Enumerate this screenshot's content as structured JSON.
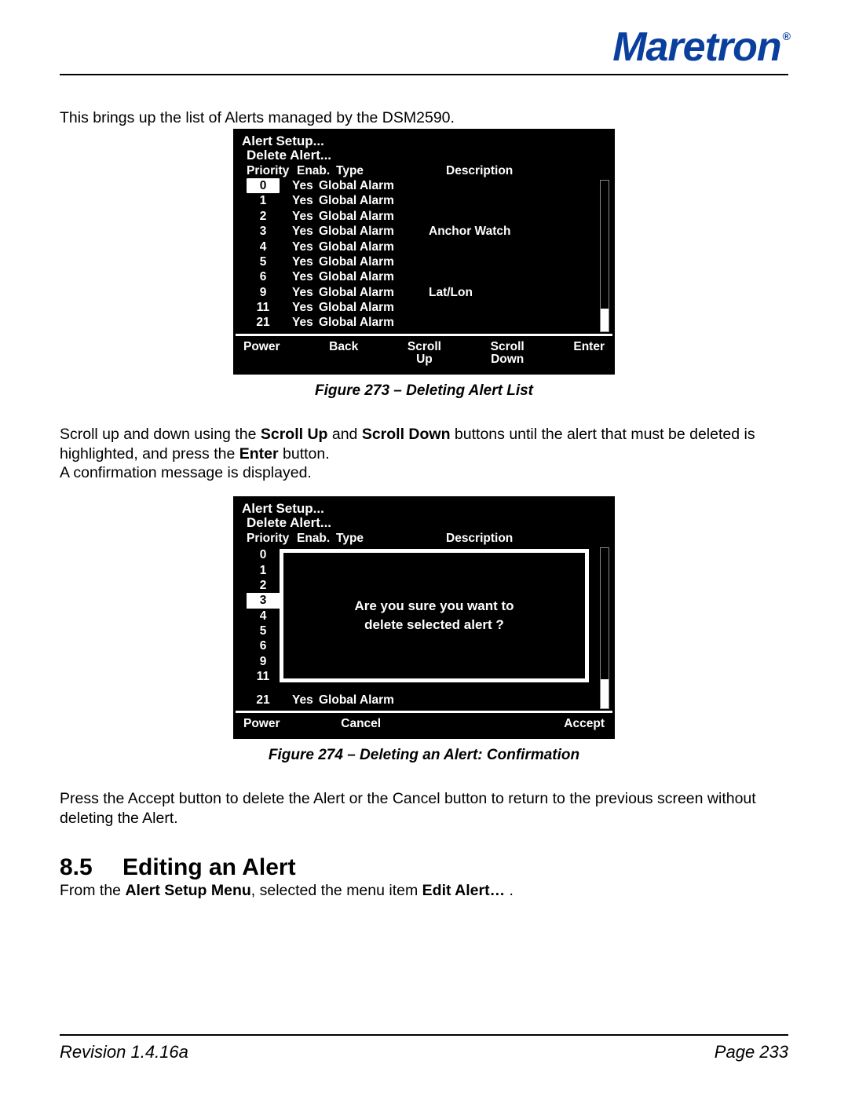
{
  "brand": {
    "name": "Maretron",
    "reg": "®"
  },
  "intro": "This brings up the list of Alerts managed by the DSM2590.",
  "device1": {
    "crumb1": "Alert Setup...",
    "crumb2": "Delete Alert...",
    "headers": {
      "priority": "Priority",
      "enab": "Enab.",
      "type": "Type",
      "desc": "Description"
    },
    "rows": [
      {
        "p": "0",
        "e": "Yes",
        "t": "Global Alarm",
        "d": "",
        "sel": true
      },
      {
        "p": "1",
        "e": "Yes",
        "t": "Global Alarm",
        "d": "",
        "sel": false
      },
      {
        "p": "2",
        "e": "Yes",
        "t": "Global Alarm",
        "d": "",
        "sel": false
      },
      {
        "p": "3",
        "e": "Yes",
        "t": "Global Alarm",
        "d": "Anchor Watch",
        "sel": false
      },
      {
        "p": "4",
        "e": "Yes",
        "t": "Global Alarm",
        "d": "",
        "sel": false
      },
      {
        "p": "5",
        "e": "Yes",
        "t": "Global Alarm",
        "d": "",
        "sel": false
      },
      {
        "p": "6",
        "e": "Yes",
        "t": "Global Alarm",
        "d": "",
        "sel": false
      },
      {
        "p": "9",
        "e": "Yes",
        "t": "Global Alarm",
        "d": "Lat/Lon",
        "sel": false
      },
      {
        "p": "11",
        "e": "Yes",
        "t": "Global Alarm",
        "d": "",
        "sel": false
      },
      {
        "p": "21",
        "e": "Yes",
        "t": "Global Alarm",
        "d": "",
        "sel": false
      }
    ],
    "softkeys": {
      "k1": "Power",
      "k2": "Back",
      "k3a": "Scroll",
      "k3b": "Up",
      "k4a": "Scroll",
      "k4b": "Down",
      "k5": "Enter"
    }
  },
  "caption1": "Figure 273 – Deleting Alert List",
  "mid_text": {
    "l1a": "Scroll up and down using the ",
    "b1": "Scroll Up",
    "l1b": " and ",
    "b2": "Scroll Down",
    "l1c": " buttons until the alert that must be deleted is highlighted, and press the ",
    "b3": "Enter",
    "l1d": " button.",
    "l2": "A confirmation message is displayed."
  },
  "device2": {
    "crumb1": "Alert Setup...",
    "crumb2": "Delete Alert...",
    "headers": {
      "priority": "Priority",
      "enab": "Enab.",
      "type": "Type",
      "desc": "Description"
    },
    "priorities": [
      {
        "p": "0",
        "sel": false
      },
      {
        "p": "1",
        "sel": false
      },
      {
        "p": "2",
        "sel": false
      },
      {
        "p": "3",
        "sel": true
      },
      {
        "p": "4",
        "sel": false
      },
      {
        "p": "5",
        "sel": false
      },
      {
        "p": "6",
        "sel": false
      },
      {
        "p": "9",
        "sel": false
      },
      {
        "p": "11",
        "sel": false
      }
    ],
    "lastrow": {
      "p": "21",
      "e": "Yes",
      "t": "Global Alarm"
    },
    "dialog": {
      "l1": "Are you sure you want to",
      "l2": "delete selected alert ?"
    },
    "softkeys": {
      "k1": "Power",
      "k2": "Cancel",
      "k5": "Accept"
    }
  },
  "caption2": "Figure 274 – Deleting an Alert: Confirmation",
  "after_text": "Press the Accept button to delete the Alert or the Cancel button to return to the previous screen without deleting the Alert.",
  "section": {
    "num": "8.5",
    "title": "Editing an Alert"
  },
  "section_body": {
    "a": "From the ",
    "b1": "Alert Setup Menu",
    "b": ", selected the menu item ",
    "b2": "Edit Alert…",
    "c": " ."
  },
  "footer": {
    "rev": "Revision 1.4.16a",
    "page": "Page 233"
  }
}
